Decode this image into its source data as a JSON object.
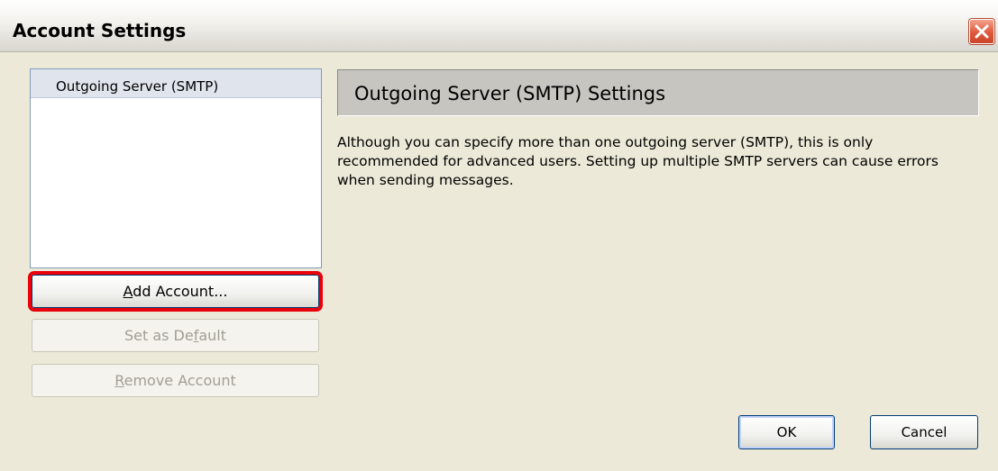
{
  "window": {
    "title": "Account Settings"
  },
  "accounts": {
    "items": [
      {
        "label": "Outgoing Server (SMTP)"
      }
    ]
  },
  "left_buttons": {
    "add_prefix": "",
    "add_mnemonic": "A",
    "add_rest": "dd Account...",
    "default_prefix": "Set as De",
    "default_mnemonic": "f",
    "default_rest": "ault",
    "remove_prefix": "",
    "remove_mnemonic": "R",
    "remove_rest": "emove Account"
  },
  "settings": {
    "title": "Outgoing Server (SMTP) Settings",
    "description": "Although you can specify more than one outgoing server (SMTP), this is only recommended for advanced users. Setting up multiple SMTP servers can cause errors when sending messages."
  },
  "dialog_buttons": {
    "ok": "OK",
    "cancel": "Cancel"
  },
  "icons": {
    "close": "close-icon"
  },
  "colors": {
    "highlight_border": "#e8000b",
    "close_button": "#e0593b"
  }
}
